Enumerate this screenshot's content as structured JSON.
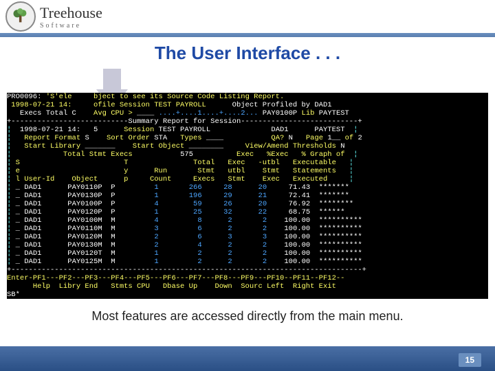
{
  "brand": "Treehouse",
  "brand_sub": "Software",
  "slide_title": "The User Interface . . .",
  "caption": "Most features are accessed directly from the main menu.",
  "page_num": "15",
  "term": {
    "line1_a": "PRO0096: ",
    "line1_b": "'S'ele",
    "line1_c": "     bject to see its Source Code Listing Report.",
    "line2_a": " 1998-07-21 14:",
    "line2_b": "     ofile Session TEST PAYROLL      ",
    "line2_c": "Object Profiled by DAD1",
    "line3_a": "   Execs Total C",
    "line3_b": "    Avg CPU > ",
    "line3_c": "____ ",
    "line3_d": "....+....1....+....2... ",
    "line3_e": "PAY0100P ",
    "line3_f": "Lib ",
    "line3_g": "PAYTEST",
    "border_top": "+---------------------------Summary Report for Session---------------------------+",
    "l4": "¦  1998-07-21 14:    5      Session TEST PAYROLL              DAD1      PAYTEST  ¦",
    "l5": "¦   Report Format S    Sort Order STA   Types ____            QA? N   Page 1__ of 2",
    "l6": "¦   Start Library _______    Start Object ________     View/Amend Thresholds N",
    "l7": "¦            Total Stmt Execs           575          Exec   %Exec   % Graph of  ¦",
    "l8": "¦ S                        T               Total   Exec   -utbl   Executable   ¦",
    "l9": "¦ e                        y      Run       Stmt   utbl    Stmt   Statements   ¦",
    "l10": "¦ l User-Id    Object      p     Count     Execs   Stmt    Exec   Executed     ¦",
    "rows": [
      {
        "sel": "_",
        "uid": "DAD1",
        "obj": "PAY0110P",
        "typ": "P",
        "cnt": "1",
        "ex": "266",
        "ut": "28",
        "st": "20",
        "pct": "71.43",
        "bar": "*******"
      },
      {
        "sel": "_",
        "uid": "DAD1",
        "obj": "PAY0130P",
        "typ": "P",
        "cnt": "1",
        "ex": "196",
        "ut": "29",
        "st": "21",
        "pct": "72.41",
        "bar": "*******"
      },
      {
        "sel": "_",
        "uid": "DAD1",
        "obj": "PAY0100P",
        "typ": "P",
        "cnt": "4",
        "ex": "59",
        "ut": "26",
        "st": "20",
        "pct": "76.92",
        "bar": "********"
      },
      {
        "sel": "_",
        "uid": "DAD1",
        "obj": "PAY0120P",
        "typ": "P",
        "cnt": "1",
        "ex": "25",
        "ut": "32",
        "st": "22",
        "pct": "68.75",
        "bar": "******"
      },
      {
        "sel": "_",
        "uid": "DAD1",
        "obj": "PAY0100M",
        "typ": "M",
        "cnt": "4",
        "ex": "8",
        "ut": "2",
        "st": "2",
        "pct": "100.00",
        "bar": "**********"
      },
      {
        "sel": "_",
        "uid": "DAD1",
        "obj": "PAY0110M",
        "typ": "M",
        "cnt": "3",
        "ex": "6",
        "ut": "2",
        "st": "2",
        "pct": "100.00",
        "bar": "**********"
      },
      {
        "sel": "_",
        "uid": "DAD1",
        "obj": "PAY0120M",
        "typ": "M",
        "cnt": "2",
        "ex": "6",
        "ut": "3",
        "st": "3",
        "pct": "100.00",
        "bar": "**********"
      },
      {
        "sel": "_",
        "uid": "DAD1",
        "obj": "PAY0130M",
        "typ": "M",
        "cnt": "2",
        "ex": "4",
        "ut": "2",
        "st": "2",
        "pct": "100.00",
        "bar": "**********"
      },
      {
        "sel": "_",
        "uid": "DAD1",
        "obj": "PAY0120T",
        "typ": "M",
        "cnt": "1",
        "ex": "2",
        "ut": "2",
        "st": "2",
        "pct": "100.00",
        "bar": "**********"
      },
      {
        "sel": "_",
        "uid": "DAD1",
        "obj": "PAY0125M",
        "typ": "M",
        "cnt": "1",
        "ex": "2",
        "ut": "2",
        "st": "2",
        "pct": "100.00",
        "bar": "**********"
      }
    ],
    "border_bot": "+---------------------------------------------------------------------------------+",
    "pf1": "Enter-PF1---PF2---PF3---PF4---PF5---PF6---PF7---PF8---PF9---PF10--PF11--PF12--",
    "pf2": "      Help  Libry End   Stmts CPU   Dbase Up    Down  Sourc Left  Right Exit",
    "sb": "SB*"
  }
}
